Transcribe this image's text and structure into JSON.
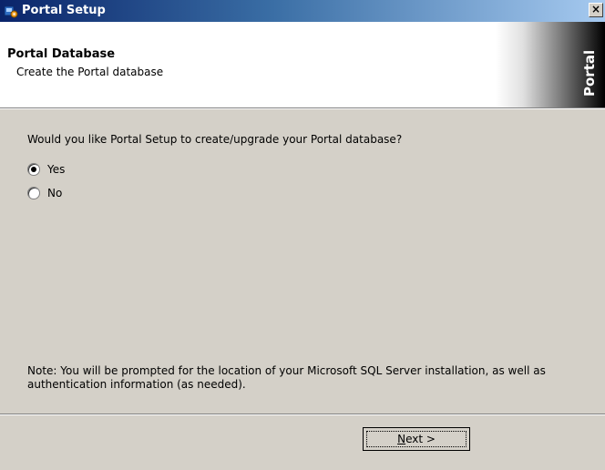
{
  "window": {
    "title": "Portal Setup",
    "close_label": "×"
  },
  "header": {
    "title": "Portal Database",
    "subtitle": "Create the Portal database",
    "banner_text": "Portal"
  },
  "content": {
    "question": "Would you like Portal Setup to create/upgrade your Portal database?",
    "options": [
      {
        "label": "Yes",
        "checked": true
      },
      {
        "label": "No",
        "checked": false
      }
    ],
    "note": "Note:  You will be prompted for the location of your Microsoft SQL Server installation, as well as authentication information (as needed)."
  },
  "buttons": {
    "next_mnemonic": "N",
    "next_rest": "ext >"
  }
}
